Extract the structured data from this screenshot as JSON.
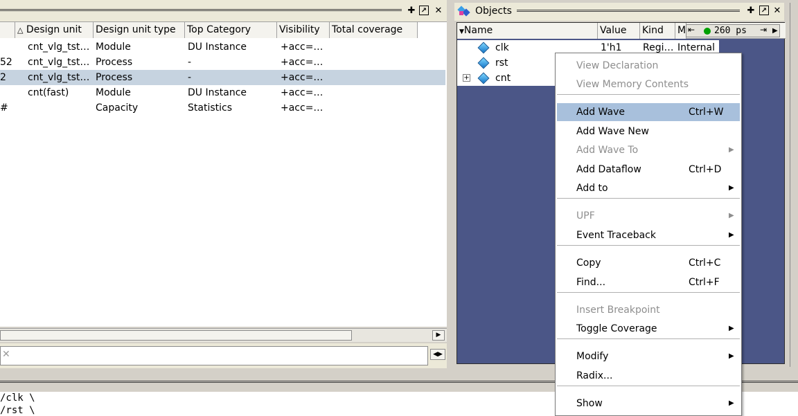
{
  "structure_panel": {
    "columns": [
      "Design unit",
      "Design unit type",
      "Top Category",
      "Visibility",
      "Total coverage"
    ],
    "rows": [
      {
        "prefix": "",
        "unit": "cnt_vlg_tst…",
        "type": "Module",
        "category": "DU Instance",
        "visibility": "+acc=…",
        "selected": false
      },
      {
        "prefix": "52",
        "unit": "cnt_vlg_tst…",
        "type": "Process",
        "category": "-",
        "visibility": "+acc=…",
        "selected": false
      },
      {
        "prefix": "2",
        "unit": "cnt_vlg_tst…",
        "type": "Process",
        "category": "-",
        "visibility": "+acc=…",
        "selected": true
      },
      {
        "prefix": "",
        "unit": "cnt(fast)",
        "type": "Module",
        "category": "DU Instance",
        "visibility": "+acc=…",
        "selected": false
      },
      {
        "prefix": "#",
        "unit": "",
        "type": "Capacity",
        "category": "Statistics",
        "visibility": "+acc=…",
        "selected": false
      }
    ],
    "sort_glyph": "△"
  },
  "objects_panel": {
    "title": "Objects",
    "columns": {
      "name": "Name",
      "value": "Value",
      "kind": "Kind",
      "mode": "M"
    },
    "time_display": "260 ps",
    "rows": [
      {
        "name": "clk",
        "value": "1'h1",
        "kind": "Regi…",
        "mode": "Internal"
      },
      {
        "name": "rst",
        "value": "",
        "kind": "",
        "mode": ""
      },
      {
        "name": "cnt",
        "value": "",
        "kind": "",
        "mode": "",
        "expand": "+"
      }
    ]
  },
  "transcript": {
    "lines": [
      "/clk \\",
      "/rst \\"
    ]
  },
  "context_menu": {
    "items": [
      {
        "label": "View Declaration",
        "shortcut": "",
        "submenu": false,
        "disabled": true
      },
      {
        "label": "View Memory Contents",
        "shortcut": "",
        "submenu": false,
        "disabled": true
      },
      {
        "label": "Add Wave",
        "shortcut": "Ctrl+W",
        "submenu": false,
        "disabled": false,
        "highlighted": true
      },
      {
        "label": "Add Wave New",
        "shortcut": "",
        "submenu": false,
        "disabled": false
      },
      {
        "label": "Add Wave To",
        "shortcut": "",
        "submenu": true,
        "disabled": true
      },
      {
        "label": "Add Dataflow",
        "shortcut": "Ctrl+D",
        "submenu": false,
        "disabled": false
      },
      {
        "label": "Add to",
        "shortcut": "",
        "submenu": true,
        "disabled": false
      },
      {
        "label": "UPF",
        "shortcut": "",
        "submenu": true,
        "disabled": true
      },
      {
        "label": "Event Traceback",
        "shortcut": "",
        "submenu": true,
        "disabled": false
      },
      {
        "label": "Copy",
        "shortcut": "Ctrl+C",
        "submenu": false,
        "disabled": false
      },
      {
        "label": "Find...",
        "shortcut": "Ctrl+F",
        "submenu": false,
        "disabled": false
      },
      {
        "label": "Insert Breakpoint",
        "shortcut": "",
        "submenu": false,
        "disabled": true
      },
      {
        "label": "Toggle Coverage",
        "shortcut": "",
        "submenu": true,
        "disabled": false
      },
      {
        "label": "Modify",
        "shortcut": "",
        "submenu": true,
        "disabled": false
      },
      {
        "label": "Radix...",
        "shortcut": "",
        "submenu": false,
        "disabled": false
      },
      {
        "label": "Show",
        "shortcut": "",
        "submenu": true,
        "disabled": false
      }
    ]
  },
  "icons": {
    "undock": "undock-icon",
    "maximize": "maximize-icon",
    "close": "close-icon",
    "submenu_arrow": "▶",
    "running_indicator": "#00a000",
    "object_diamond": "#1476c8"
  },
  "colors": {
    "objects_background": "#4b5687",
    "selection": "#c6d3e0",
    "menu_highlight": "#a8c0dc"
  }
}
